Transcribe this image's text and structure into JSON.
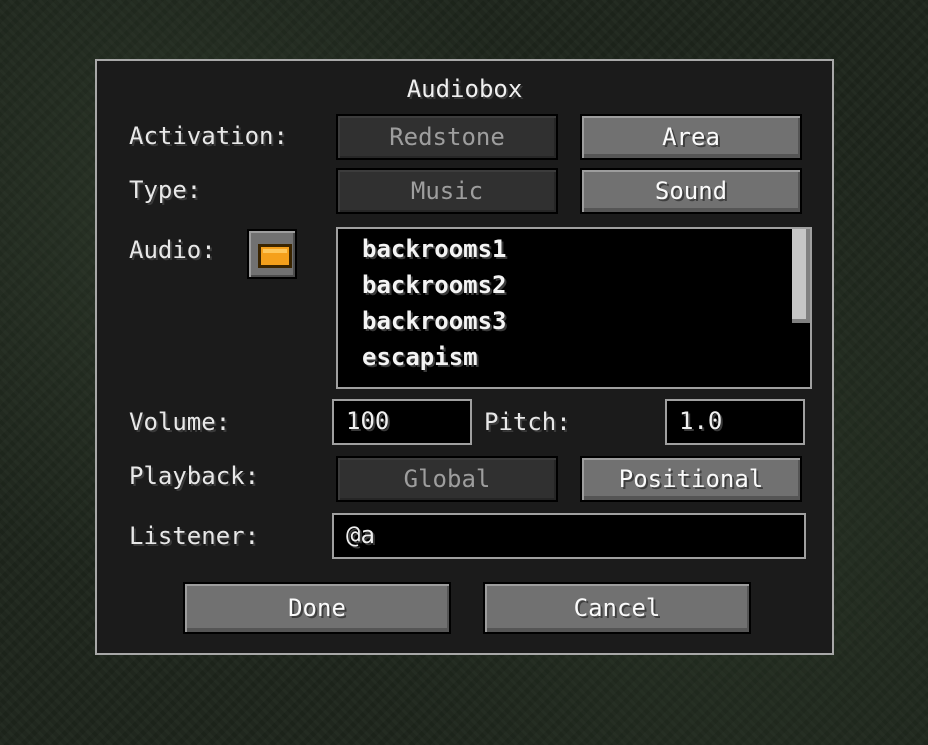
{
  "dialog": {
    "title": "Audiobox",
    "activation": {
      "label": "Activation:",
      "options": [
        "Redstone",
        "Area"
      ],
      "selected": "Redstone"
    },
    "type": {
      "label": "Type:",
      "options": [
        "Music",
        "Sound"
      ],
      "selected": "Music"
    },
    "audio": {
      "label": "Audio:",
      "folder_icon": "folder-icon",
      "items": [
        "backrooms1",
        "backrooms2",
        "backrooms3",
        "escapism"
      ]
    },
    "volume": {
      "label": "Volume:",
      "value": "100"
    },
    "pitch": {
      "label": "Pitch:",
      "value": "1.0"
    },
    "playback": {
      "label": "Playback:",
      "options": [
        "Global",
        "Positional"
      ],
      "selected": "Global"
    },
    "listener": {
      "label": "Listener:",
      "value": "@a"
    },
    "done_label": "Done",
    "cancel_label": "Cancel"
  },
  "colors": {
    "panel_border": "#a8a8a8",
    "button_face": "#717171",
    "button_disabled": "#303030",
    "folder_accent": "#f5a01b"
  }
}
